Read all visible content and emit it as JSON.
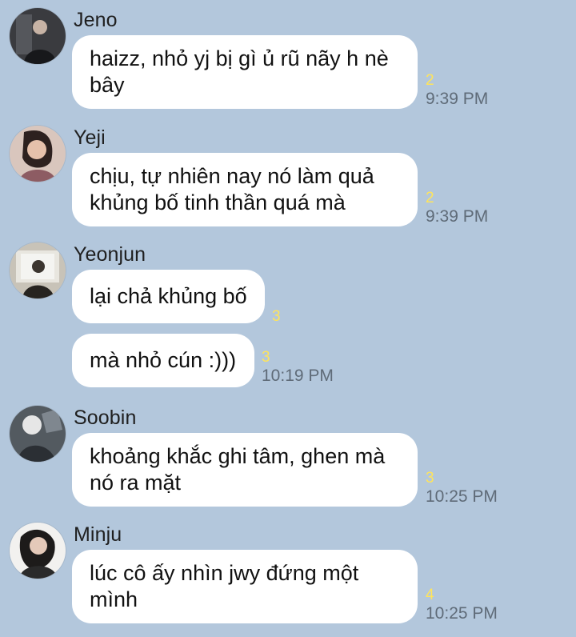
{
  "conversation": {
    "messages": [
      {
        "sender": "Jeno",
        "avatar_icon": "person-avatar-icon",
        "bubbles": [
          {
            "text": "haizz, nhỏ yj bị gì ủ rũ nãy h nè\nbây",
            "read_count": "2",
            "time": "9:39 PM"
          }
        ]
      },
      {
        "sender": "Yeji",
        "avatar_icon": "person-avatar-icon",
        "bubbles": [
          {
            "text": "chịu, tự nhiên nay nó làm quả\nkhủng bố tinh thần quá mà",
            "read_count": "2",
            "time": "9:39 PM"
          }
        ]
      },
      {
        "sender": "Yeonjun",
        "avatar_icon": "person-avatar-icon",
        "bubbles": [
          {
            "text": "lại chả khủng bố",
            "read_count": "3"
          },
          {
            "text": "mà nhỏ cún :)))",
            "read_count": "3",
            "time": "10:19 PM"
          }
        ]
      },
      {
        "sender": "Soobin",
        "avatar_icon": "person-avatar-icon",
        "bubbles": [
          {
            "text": "khoảng khắc ghi tâm, ghen mà\nnó ra mặt",
            "read_count": "3",
            "time": "10:25 PM"
          }
        ]
      },
      {
        "sender": "Minju",
        "avatar_icon": "person-avatar-icon",
        "bubbles": [
          {
            "text": "lúc cô ấy nhìn jwy đứng một\nmình",
            "read_count": "4",
            "time": "10:25 PM"
          }
        ]
      }
    ]
  },
  "colors": {
    "background": "#b3c7dc",
    "bubble": "#ffffff",
    "read_count": "#ffe45a",
    "timestamp": "#5f6b78"
  }
}
